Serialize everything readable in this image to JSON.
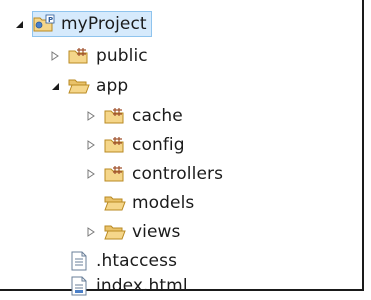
{
  "tree": {
    "root": {
      "label": "myProject",
      "expanded": true,
      "icon": "project-icon"
    },
    "children": [
      {
        "label": "public",
        "expanded": false,
        "icon": "package-folder-icon"
      },
      {
        "label": "app",
        "expanded": true,
        "icon": "open-folder-icon"
      },
      {
        "label": "cache",
        "expanded": false,
        "icon": "package-folder-icon"
      },
      {
        "label": "config",
        "expanded": false,
        "icon": "package-folder-icon"
      },
      {
        "label": "controllers",
        "expanded": false,
        "icon": "package-folder-icon"
      },
      {
        "label": "models",
        "icon": "open-folder-icon"
      },
      {
        "label": "views",
        "expanded": false,
        "icon": "open-folder-icon"
      },
      {
        "label": ".htaccess",
        "icon": "text-file-icon"
      },
      {
        "label": "index.html",
        "icon": "html-file-icon"
      }
    ]
  },
  "colors": {
    "selection_bg": "#d6eafc",
    "selection_border": "#8fc4ee",
    "folder_fill": "#f5d68a",
    "folder_stroke": "#b98a22",
    "package_grid": "#a0522d"
  }
}
